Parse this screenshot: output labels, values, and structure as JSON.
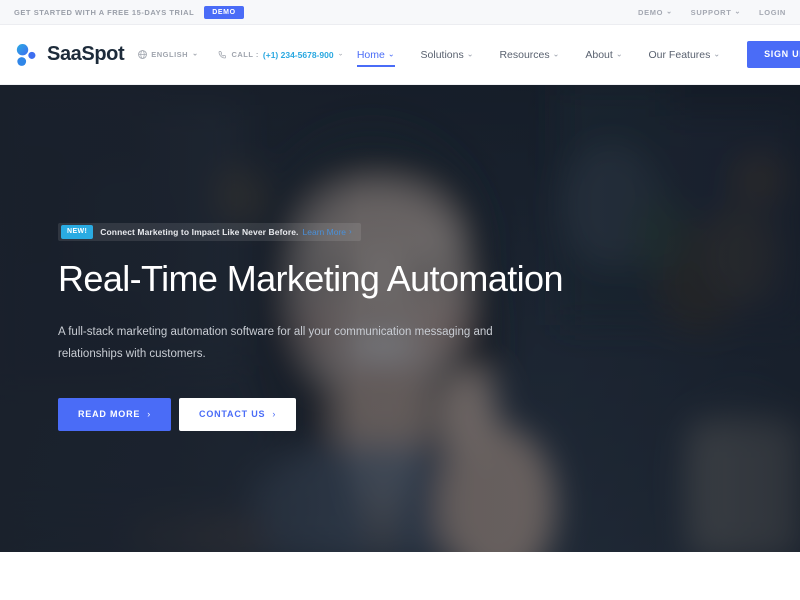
{
  "topbar": {
    "note": "Get started with a free 15-days trial",
    "demo_badge": "DEMO",
    "links": [
      {
        "label": "Demo",
        "has_caret": true
      },
      {
        "label": "Support",
        "has_caret": true
      },
      {
        "label": "Login",
        "has_caret": false
      }
    ]
  },
  "header": {
    "brand_name": "SaaSpot",
    "logo_icon": "molecule-logo-icon",
    "language": {
      "icon": "globe-icon",
      "label": "English",
      "caret": "⌄"
    },
    "call": {
      "icon": "phone-icon",
      "label": "Call :",
      "number": "(+1) 234-5678-900",
      "caret": "⌄"
    },
    "nav": [
      {
        "label": "Home",
        "caret": "⌄",
        "active": true
      },
      {
        "label": "Solutions",
        "caret": "⌄",
        "active": false
      },
      {
        "label": "Resources",
        "caret": "⌄",
        "active": false
      },
      {
        "label": "About",
        "caret": "⌄",
        "active": false
      },
      {
        "label": "Our Features",
        "caret": "⌄",
        "active": false
      }
    ],
    "signup_label": "Sign Up"
  },
  "hero": {
    "banner": {
      "badge": "NEW!",
      "text": "Connect Marketing to Impact Like Never Before.",
      "link_label": "Learn More",
      "link_arrow": "›"
    },
    "title": "Real-Time Marketing Automation",
    "subtitle": "A full-stack marketing automation software for all your communication messaging and relationships with customers.",
    "primary_btn": {
      "label": "Read More",
      "arrow": "›"
    },
    "secondary_btn": {
      "label": "Contact Us",
      "arrow": "›"
    },
    "background": "blurred dark photo of smiling woman in office"
  },
  "colors": {
    "brand_blue": "#4a6cf7",
    "accent_cyan": "#2aabe2",
    "dark_navy": "#1d2b3a",
    "topbar_bg": "#f7f8fa",
    "muted_text": "#a0a5ae"
  }
}
